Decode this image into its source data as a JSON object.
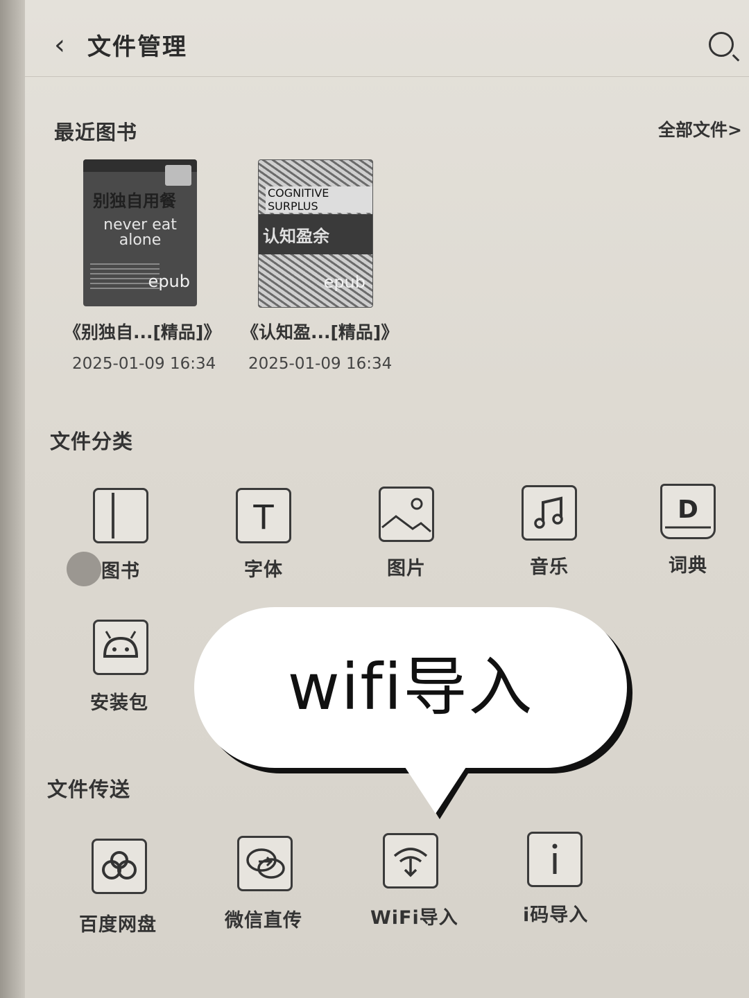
{
  "header": {
    "title": "文件管理"
  },
  "recent": {
    "heading": "最近图书",
    "all_files": "全部文件>",
    "books": [
      {
        "name": "《别独自...[精品]》",
        "date": "2025-01-09 16:34",
        "cover_title_zh": "别独自用餐",
        "cover_title_en": "never eat alone",
        "format": "epub"
      },
      {
        "name": "《认知盈...[精品]》",
        "date": "2025-01-09 16:34",
        "cover_title_zh": "认知盈余",
        "cover_title_en": "COGNITIVE SURPLUS",
        "format": "epub"
      }
    ]
  },
  "categories": {
    "heading": "文件分类",
    "items": [
      {
        "label": "图书",
        "icon": "book-icon"
      },
      {
        "label": "字体",
        "icon": "font-icon"
      },
      {
        "label": "图片",
        "icon": "image-icon"
      },
      {
        "label": "音乐",
        "icon": "music-icon"
      },
      {
        "label": "词典",
        "icon": "dictionary-icon"
      },
      {
        "label": "安装包",
        "icon": "android-package-icon"
      }
    ]
  },
  "transfer": {
    "heading": "文件传送",
    "items": [
      {
        "label": "百度网盘",
        "icon": "cloud-icon"
      },
      {
        "label": "微信直传",
        "icon": "wechat-transfer-icon"
      },
      {
        "label": "WiFi导入",
        "icon": "wifi-download-icon"
      },
      {
        "label": "i码导入",
        "icon": "i-code-icon"
      }
    ]
  },
  "callout": {
    "text": "wifi导入"
  }
}
